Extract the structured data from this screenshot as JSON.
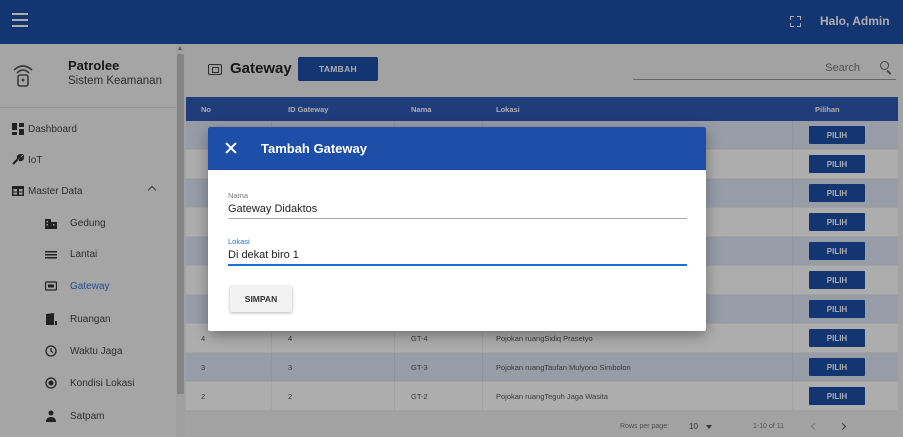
{
  "topbar": {
    "greeting": "Halo, Admin"
  },
  "sidebar": {
    "brand_title": "Patrolee",
    "brand_subtitle": "Sistem Keamanan",
    "items": [
      {
        "label": "Dashboard",
        "icon": "dashboard-icon"
      },
      {
        "label": "IoT",
        "icon": "wrench-icon"
      },
      {
        "label": "Master Data",
        "icon": "table-icon"
      },
      {
        "label": "Gedung",
        "icon": "building-icon"
      },
      {
        "label": "Lantai",
        "icon": "list-icon"
      },
      {
        "label": "Gateway",
        "icon": "gateway-icon"
      },
      {
        "label": "Ruangan",
        "icon": "room-icon"
      },
      {
        "label": "Waktu Jaga",
        "icon": "clock-icon"
      },
      {
        "label": "Kondisi Lokasi",
        "icon": "radio-icon"
      },
      {
        "label": "Satpam",
        "icon": "person-icon"
      }
    ]
  },
  "page": {
    "title": "Gateway",
    "add_button": "TAMBAH",
    "search_placeholder": "Search"
  },
  "table": {
    "headers": [
      "No",
      "ID Gateway",
      "Nama",
      "Lokasi",
      "Pilihan"
    ],
    "rows": [
      {
        "no": "",
        "id": "",
        "nama": "",
        "lokasi": "",
        "action": "PILIH"
      },
      {
        "no": "",
        "id": "",
        "nama": "",
        "lokasi": "",
        "action": "PILIH"
      },
      {
        "no": "",
        "id": "",
        "nama": "",
        "lokasi": "",
        "action": "PILIH"
      },
      {
        "no": "",
        "id": "",
        "nama": "",
        "lokasi": "",
        "action": "PILIH"
      },
      {
        "no": "",
        "id": "",
        "nama": "",
        "lokasi": "",
        "action": "PILIH"
      },
      {
        "no": "",
        "id": "",
        "nama": "",
        "lokasi": "",
        "action": "PILIH"
      },
      {
        "no": "",
        "id": "",
        "nama": "",
        "lokasi": "",
        "action": "PILIH"
      },
      {
        "no": "4",
        "id": "4",
        "nama": "GT-4",
        "lokasi": "Pojokan ruangSidiq Prasetyo",
        "action": "PILIH"
      },
      {
        "no": "3",
        "id": "3",
        "nama": "GT-3",
        "lokasi": "Pojokan ruangTaufan Mulyono Simbolon",
        "action": "PILIH"
      },
      {
        "no": "2",
        "id": "2",
        "nama": "GT-2",
        "lokasi": "Pojokan ruangTeguh Jaga Wasita",
        "action": "PILIH"
      }
    ]
  },
  "pagination": {
    "rows_per_page_label": "Rows per page:",
    "rows_per_page": "10",
    "range": "1-10 of 11"
  },
  "dialog": {
    "title": "Tambah Gateway",
    "nama_label": "Nama",
    "nama_value": "Gateway Didaktos",
    "lokasi_label": "Lokasi",
    "lokasi_value": "Di dekat biro 1",
    "submit": "SIMPAN"
  },
  "colors": {
    "primary": "#1d4ea8",
    "table_header": "#2e5bb4",
    "row_stripe": "#dfe6f7",
    "focus": "#1d6fd8"
  }
}
